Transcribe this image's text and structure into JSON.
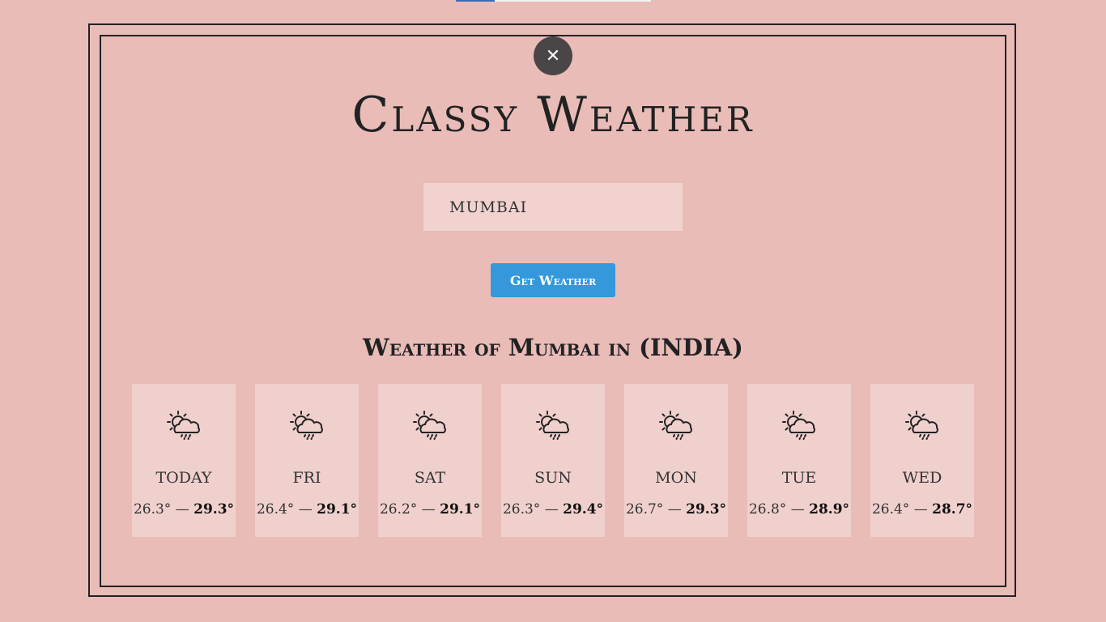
{
  "app": {
    "title": "Classy Weather"
  },
  "search": {
    "value": "MUMBAI"
  },
  "actions": {
    "close_label": "✕",
    "get_weather_label": "Get Weather"
  },
  "location_heading": "Weather of Mumbai in (INDIA)",
  "forecast": [
    {
      "day": "TODAY",
      "icon": "sun-cloud-rain-icon",
      "min": "26.3°",
      "max": "29.3°"
    },
    {
      "day": "FRI",
      "icon": "sun-cloud-rain-icon",
      "min": "26.4°",
      "max": "29.1°"
    },
    {
      "day": "SAT",
      "icon": "sun-cloud-rain-icon",
      "min": "26.2°",
      "max": "29.1°"
    },
    {
      "day": "SUN",
      "icon": "sun-cloud-rain-icon",
      "min": "26.3°",
      "max": "29.4°"
    },
    {
      "day": "MON",
      "icon": "sun-cloud-rain-icon",
      "min": "26.7°",
      "max": "29.3°"
    },
    {
      "day": "TUE",
      "icon": "sun-cloud-rain-icon",
      "min": "26.8°",
      "max": "28.9°"
    },
    {
      "day": "WED",
      "icon": "sun-cloud-rain-icon",
      "min": "26.4°",
      "max": "28.7°"
    }
  ],
  "temp_separator": "—",
  "colors": {
    "background": "#e9bcb8",
    "card": "#f0d0cd",
    "button": "#3498db",
    "close_button": "#4a4648"
  }
}
